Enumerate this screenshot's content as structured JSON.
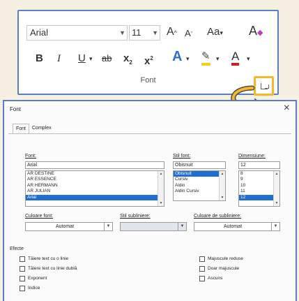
{
  "ribbon": {
    "font_name": "Arial",
    "font_size": "11",
    "grow_font": "A",
    "shrink_font": "A",
    "change_case": "Aa",
    "clear_format": "A",
    "bold": "B",
    "italic": "I",
    "underline": "U",
    "strikethrough": "ab",
    "subscript": "x",
    "subscript_mark": "2",
    "superscript": "x",
    "superscript_mark": "2",
    "text_effects": "A",
    "highlight": "✎",
    "font_color": "A",
    "group_label": "Font",
    "colors": {
      "border": "#5b7fc1",
      "launcher_highlight": "#f5b82a",
      "text_effects": "#2f6fd6",
      "highlight": "#f2d21b",
      "font_color": "#d02020"
    }
  },
  "dialog": {
    "title": "Font",
    "close": "×",
    "tabs": [
      "Font",
      "Complex"
    ],
    "font_label": "Font:",
    "font_value": "Arial",
    "font_list": [
      "AR DESTINE",
      "AR ESSENCE",
      "AR HERMANN",
      "AR JULIAN",
      "Arial"
    ],
    "font_list_selected": 4,
    "style_label": "Stil font:",
    "style_value": "Obisnuit",
    "style_list": [
      "Obisnuit",
      "Cursiv",
      "Aldin",
      "Aldin Cursiv"
    ],
    "style_list_selected": 0,
    "size_label": "Dimensiune:",
    "size_value": "12",
    "size_list": [
      "8",
      "9",
      "10",
      "11",
      "12"
    ],
    "size_list_selected": 4,
    "font_color_label": "Culoare font:",
    "font_color_value": "Automat",
    "underline_style_label": "Stil subliniere:",
    "underline_style_value": "",
    "underline_color_label": "Culoare de subliniere:",
    "underline_color_value": "Automat",
    "effects_label": "Efecte",
    "effects_left": [
      "Tăiere text cu o linie",
      "Tăiere text cu linie dublă",
      "Exponent",
      "Indice"
    ],
    "effects_right": [
      "Majuscule reduse",
      "Doar majuscule",
      "Ascuns"
    ],
    "colors": {
      "selection": "#1f6fd1",
      "disabled_field": "#e1e5ec"
    }
  },
  "icons": {
    "launcher": "dialog-launcher-icon",
    "arrow": "curved-arrow-icon"
  }
}
